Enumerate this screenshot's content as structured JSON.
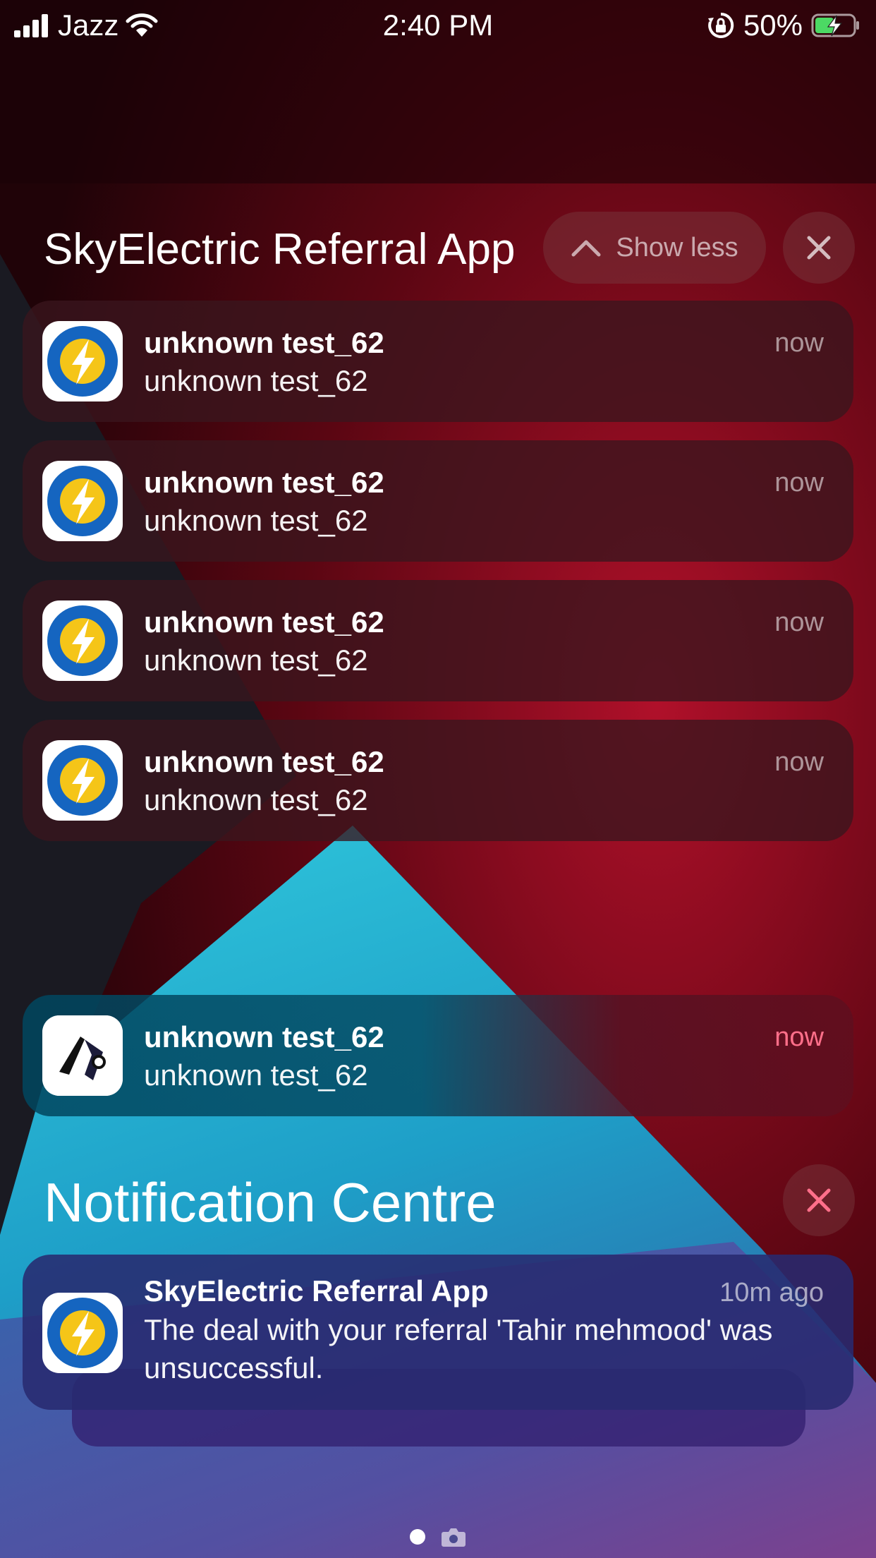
{
  "status_bar": {
    "carrier": "Jazz",
    "time": "2:40 PM",
    "battery_percent": "50%",
    "battery_level": 0.5,
    "icons": [
      "signal-icon",
      "wifi-icon",
      "rotation-lock-icon",
      "battery-charging-icon"
    ]
  },
  "group": {
    "title": "SkyElectric Referral App",
    "show_less_label": "Show less",
    "notifications": [
      {
        "title": "unknown test_62",
        "body": "unknown test_62",
        "time": "now"
      },
      {
        "title": "unknown test_62",
        "body": "unknown test_62",
        "time": "now"
      },
      {
        "title": "unknown test_62",
        "body": "unknown test_62",
        "time": "now"
      },
      {
        "title": "unknown test_62",
        "body": "unknown test_62",
        "time": "now"
      }
    ]
  },
  "standalone_notification": {
    "title": "unknown test_62",
    "body": "unknown test_62",
    "time": "now",
    "icon": "app-logo-icon"
  },
  "notification_centre": {
    "title": "Notification Centre",
    "notification": {
      "title": "SkyElectric Referral App",
      "body": "The deal with your referral 'Tahir mehmood' was unsuccessful.",
      "time": "10m ago"
    }
  },
  "colors": {
    "accent_pink": "#ff6f8a",
    "brand_blue": "#1565c0",
    "brand_yellow": "#f5c518",
    "battery_green": "#4cd964"
  }
}
